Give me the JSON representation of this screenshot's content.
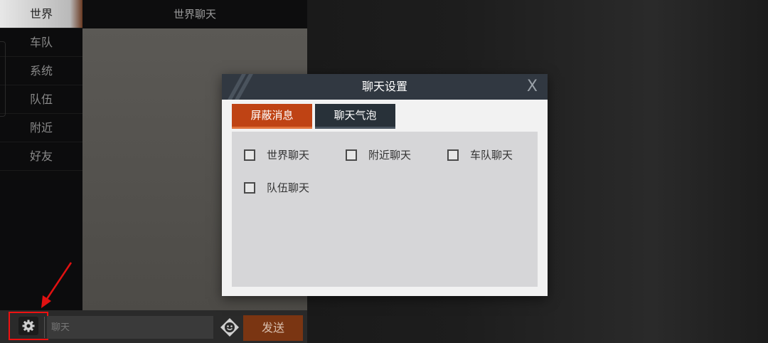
{
  "sidebar": {
    "items": [
      {
        "label": "世界",
        "active": true
      },
      {
        "label": "车队",
        "active": false
      },
      {
        "label": "系统",
        "active": false
      },
      {
        "label": "队伍",
        "active": false
      },
      {
        "label": "附近",
        "active": false
      },
      {
        "label": "好友",
        "active": false
      }
    ]
  },
  "chat": {
    "title": "世界聊天",
    "input_placeholder": "聊天",
    "send_label": "发送"
  },
  "dialog": {
    "title": "聊天设置",
    "close_label": "X",
    "tabs": [
      {
        "label": "屏蔽消息",
        "active": true
      },
      {
        "label": "聊天气泡",
        "active": false
      }
    ],
    "options": [
      {
        "label": "世界聊天",
        "checked": false
      },
      {
        "label": "附近聊天",
        "checked": false
      },
      {
        "label": "车队聊天",
        "checked": false
      },
      {
        "label": "队伍聊天",
        "checked": false
      }
    ]
  },
  "icons": {
    "settings": "gear-icon",
    "emoji": "emoji-icon",
    "annotation": "red-arrow-icon"
  },
  "colors": {
    "accent": "#bf4314",
    "send": "#7a3512",
    "annotation": "#e11111",
    "dialog_header": "#313841"
  }
}
